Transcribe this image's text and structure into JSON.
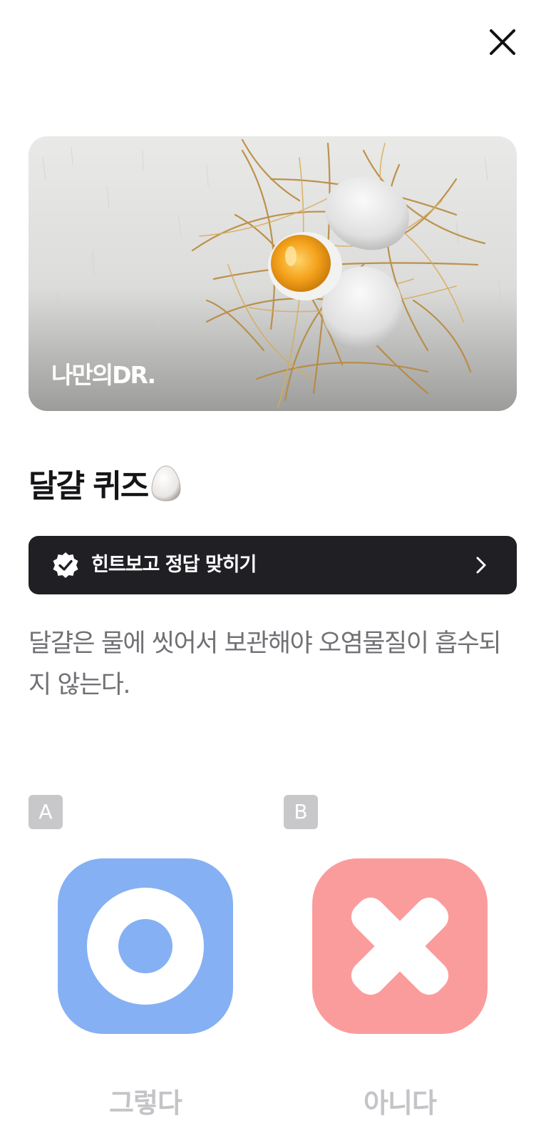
{
  "header": {
    "close_icon": "close-icon"
  },
  "hero": {
    "brand_logo": "나만의DR."
  },
  "quiz": {
    "title": "달걀 퀴즈",
    "title_emoji_icon": "egg-icon",
    "hint": {
      "icon": "verified-check-icon",
      "label": "힌트보고 정답 맞히기",
      "chevron_icon": "chevron-right-icon"
    },
    "question": "달걀은 물에 씻어서 보관해야 오염물질이 흡수되지 않는다."
  },
  "options": [
    {
      "letter": "A",
      "icon": "circle-o-icon",
      "label": "그렇다",
      "color": "#85b0f3"
    },
    {
      "letter": "B",
      "icon": "x-mark-icon",
      "label": "아니다",
      "color": "#fb9c9c"
    }
  ],
  "colors": {
    "hint_bar_bg": "#1f1f24",
    "option_letter_bg": "#c8c8cb",
    "option_label": "#c4c4c8"
  }
}
